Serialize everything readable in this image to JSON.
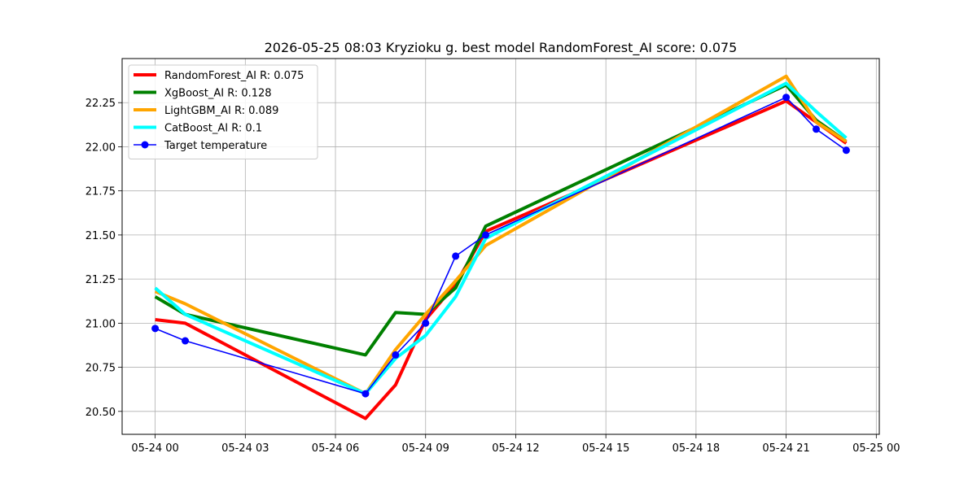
{
  "chart_data": {
    "type": "line",
    "title": "2026-05-25 08:03 Kryzioku g. best model RandomForest_AI score: 0.075",
    "xlabel": "",
    "ylabel": "",
    "x_unit": "hours",
    "x_ticks": [
      {
        "value": 0,
        "label": "05-24 00"
      },
      {
        "value": 3,
        "label": "05-24 03"
      },
      {
        "value": 6,
        "label": "05-24 06"
      },
      {
        "value": 9,
        "label": "05-24 09"
      },
      {
        "value": 12,
        "label": "05-24 12"
      },
      {
        "value": 15,
        "label": "05-24 15"
      },
      {
        "value": 18,
        "label": "05-24 18"
      },
      {
        "value": 21,
        "label": "05-24 21"
      },
      {
        "value": 24,
        "label": "05-25 00"
      }
    ],
    "y_ticks": [
      {
        "value": 20.5,
        "label": "20.50"
      },
      {
        "value": 20.75,
        "label": "20.75"
      },
      {
        "value": 21.0,
        "label": "21.00"
      },
      {
        "value": 21.25,
        "label": "21.25"
      },
      {
        "value": 21.5,
        "label": "21.50"
      },
      {
        "value": 21.75,
        "label": "21.75"
      },
      {
        "value": 22.0,
        "label": "22.00"
      },
      {
        "value": 22.25,
        "label": "22.25"
      }
    ],
    "xlim": [
      -1.1,
      24.1
    ],
    "ylim": [
      20.37,
      22.5
    ],
    "grid": true,
    "legend_position": "top-left",
    "series": [
      {
        "name": "RandomForest_AI R: 0.075",
        "color": "#ff0000",
        "width": "thick",
        "markers": false,
        "points": [
          [
            0,
            21.02
          ],
          [
            1,
            21.0
          ],
          [
            7,
            20.46
          ],
          [
            8,
            20.65
          ],
          [
            9,
            21.02
          ],
          [
            10,
            21.22
          ],
          [
            11,
            21.52
          ],
          [
            21,
            22.26
          ],
          [
            22,
            22.14
          ],
          [
            23,
            22.02
          ]
        ]
      },
      {
        "name": "XgBoost_AI R: 0.128",
        "color": "#008000",
        "width": "thick",
        "markers": false,
        "points": [
          [
            0,
            21.15
          ],
          [
            1,
            21.05
          ],
          [
            7,
            20.82
          ],
          [
            8,
            21.06
          ],
          [
            9,
            21.05
          ],
          [
            10,
            21.2
          ],
          [
            11,
            21.55
          ],
          [
            21,
            22.35
          ],
          [
            22,
            22.15
          ],
          [
            23,
            22.03
          ]
        ]
      },
      {
        "name": "LightGBM_AI R: 0.089",
        "color": "#ffa500",
        "width": "thick",
        "markers": false,
        "points": [
          [
            0,
            21.18
          ],
          [
            1,
            21.11
          ],
          [
            7,
            20.6
          ],
          [
            8,
            20.85
          ],
          [
            9,
            21.05
          ],
          [
            10,
            21.24
          ],
          [
            11,
            21.44
          ],
          [
            21,
            22.4
          ],
          [
            22,
            22.14
          ],
          [
            23,
            22.03
          ]
        ]
      },
      {
        "name": "CatBoost_AI R: 0.1",
        "color": "#00ffff",
        "width": "thick",
        "markers": false,
        "points": [
          [
            0,
            21.2
          ],
          [
            1,
            21.05
          ],
          [
            7,
            20.6
          ],
          [
            8,
            20.8
          ],
          [
            9,
            20.93
          ],
          [
            10,
            21.15
          ],
          [
            11,
            21.48
          ],
          [
            21,
            22.36
          ],
          [
            22,
            22.2
          ],
          [
            23,
            22.05
          ]
        ]
      },
      {
        "name": "Target temperature",
        "color": "#0000ff",
        "width": "thin",
        "markers": true,
        "points": [
          [
            0,
            20.97
          ],
          [
            1,
            20.9
          ],
          [
            7,
            20.6
          ],
          [
            8,
            20.82
          ],
          [
            9,
            21.0
          ],
          [
            10,
            21.38
          ],
          [
            11,
            21.5
          ],
          [
            21,
            22.28
          ],
          [
            22,
            22.1
          ],
          [
            23,
            21.98
          ]
        ]
      }
    ]
  }
}
